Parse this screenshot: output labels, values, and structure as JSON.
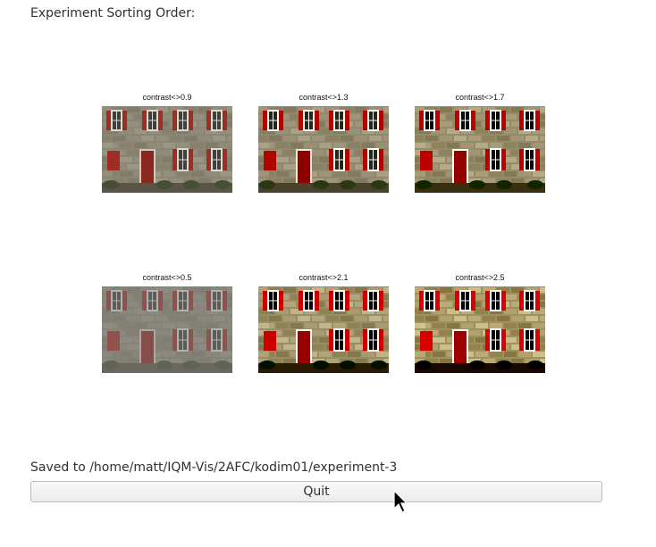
{
  "window": {
    "heading": "Experiment Sorting Order:"
  },
  "images": [
    {
      "caption": "contrast<>0.9",
      "contrast": 0.9
    },
    {
      "caption": "contrast<>1.3",
      "contrast": 1.3
    },
    {
      "caption": "contrast<>1.7",
      "contrast": 1.7
    },
    {
      "caption": "contrast<>0.5",
      "contrast": 0.5
    },
    {
      "caption": "contrast<>2.1",
      "contrast": 2.1
    },
    {
      "caption": "contrast<>2.5",
      "contrast": 2.5
    }
  ],
  "footer": {
    "saved_text": "Saved to /home/matt/IQM-Vis/2AFC/kodim01/experiment-3",
    "quit_label": "Quit"
  },
  "colors": {
    "wall": "#8d8672",
    "shutter": "#a3231c",
    "window_frame": "#e8e4da",
    "door": "#8c1e16"
  },
  "icons": {
    "cursor": "mouse-pointer-icon"
  }
}
